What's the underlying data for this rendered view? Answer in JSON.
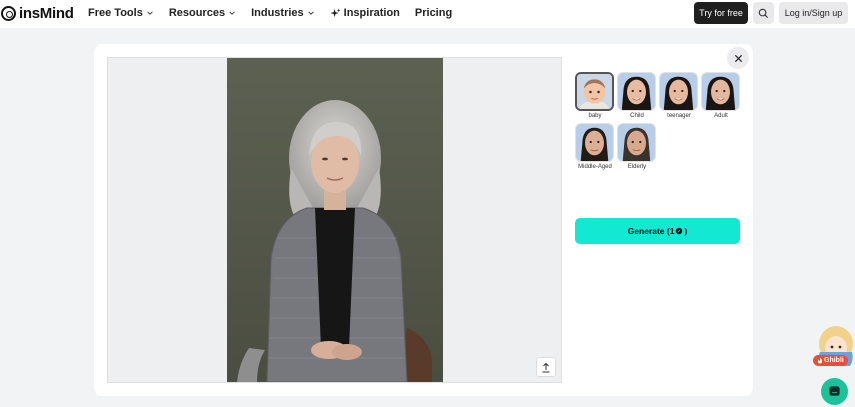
{
  "brand": {
    "name": "insMind"
  },
  "nav": {
    "free_tools": "Free Tools",
    "resources": "Resources",
    "industries": "Industries",
    "inspiration": "Inspiration",
    "pricing": "Pricing"
  },
  "header_actions": {
    "try_label": "Try for free",
    "login_label": "Log in/Sign up"
  },
  "age_options": [
    {
      "label": "baby",
      "selected": true
    },
    {
      "label": "Child",
      "selected": false
    },
    {
      "label": "teenager",
      "selected": false
    },
    {
      "label": "Adult",
      "selected": false
    },
    {
      "label": "Middle-Aged",
      "selected": false
    },
    {
      "label": "Elderly",
      "selected": false
    }
  ],
  "generate": {
    "label": "Generate (1",
    "suffix": ")"
  },
  "ghibli": {
    "badge": "Ghibli"
  },
  "colors": {
    "accent": "#13e8d2",
    "chat": "#1bc39b",
    "badge": "#e84e3b"
  }
}
